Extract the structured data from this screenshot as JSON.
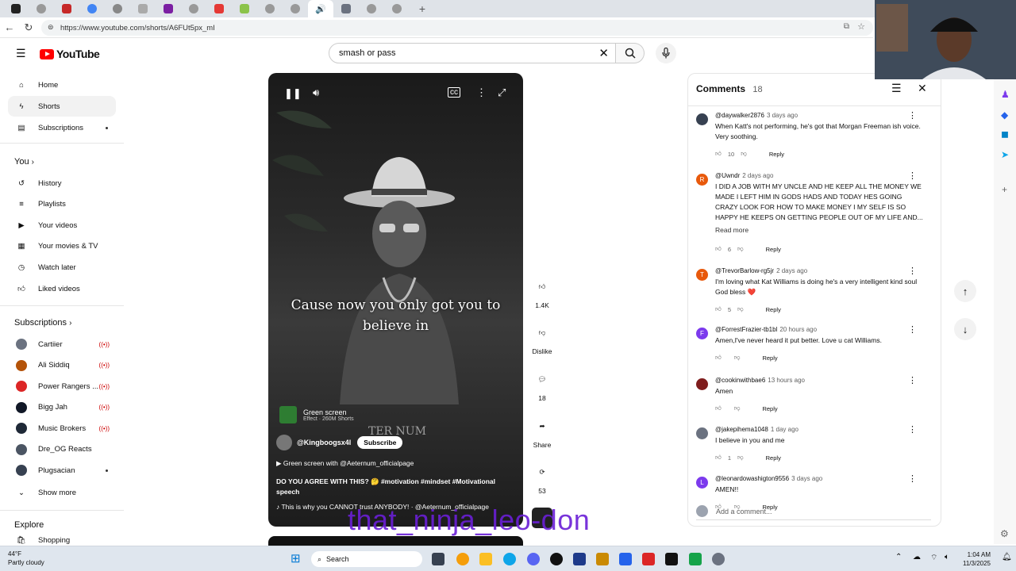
{
  "browser": {
    "url": "https://www.youtube.com/shorts/A6FUt5px_mI"
  },
  "header": {
    "logo_text": "YouTube",
    "search_value": "smash or pass"
  },
  "sidebar": {
    "main": [
      {
        "label": "Home",
        "icon": "home-icon"
      },
      {
        "label": "Shorts",
        "icon": "shorts-icon"
      },
      {
        "label": "Subscriptions",
        "icon": "subscriptions-icon"
      }
    ],
    "you_label": "You",
    "you_items": [
      {
        "label": "History",
        "icon": "history-icon"
      },
      {
        "label": "Playlists",
        "icon": "playlists-icon"
      },
      {
        "label": "Your videos",
        "icon": "your-videos-icon"
      },
      {
        "label": "Your movies & TV",
        "icon": "movies-icon"
      },
      {
        "label": "Watch later",
        "icon": "watch-later-icon"
      },
      {
        "label": "Liked videos",
        "icon": "liked-icon"
      }
    ],
    "subs_label": "Subscriptions",
    "subs": [
      {
        "label": "Cartiier",
        "color": "#6b7280",
        "live": "((•))"
      },
      {
        "label": "Ali Siddiq",
        "color": "#b45309",
        "live": "((•))"
      },
      {
        "label": "Power Rangers ...",
        "color": "#dc2626",
        "live": "((•))"
      },
      {
        "label": "Bigg Jah",
        "color": "#111827",
        "live": "((•))"
      },
      {
        "label": "Music Brokers",
        "color": "#1f2937",
        "live": "((•))"
      },
      {
        "label": "Dre_OG Reacts",
        "color": "#4b5563",
        "live": ""
      },
      {
        "label": "Plugsacian",
        "color": "#374151",
        "live": ""
      }
    ],
    "show_more": "Show more",
    "explore": "Explore",
    "shopping": "Shopping"
  },
  "video": {
    "caption_line1": "Cause now you only got you to",
    "caption_line2": "believe in",
    "effect_title": "Green screen",
    "effect_sub": "Effect · 260M Shorts",
    "channel": "@Kingboogsx4l",
    "subscribe": "Subscribe",
    "green_screen_with": "Green screen with @Aeternum_officialpage",
    "description": "DO YOU AGREE WITH THIS? 🤔 #motivation #mindset #Motivational speech",
    "sound": "This is why you CANNOT trust ANYBODY! · @Aeternum_officialpage",
    "watermark": "TER NUM"
  },
  "actions": {
    "likes": "1.4K",
    "dislike": "Dislike",
    "comments": "18",
    "share": "Share",
    "remix": "53"
  },
  "overlay": "that_ninja_leo-don",
  "comments": {
    "title": "Comments",
    "count": "18",
    "items": [
      {
        "user": "@daywalker2876",
        "time": "3 days ago",
        "text": "When Katt's not performing, he's got that Morgan Freeman ish voice. Very soothing.",
        "likes": "10",
        "avatar": "",
        "color": "#374151"
      },
      {
        "user": "@Uwndr",
        "time": "2 days ago",
        "text": "I DID A JOB WITH MY UNCLE AND HE KEEP ALL THE MONEY WE MADE I LEFT HIM IN GODS HADS AND TODAY HES GOING CRAZY LOOK FOR HOW TO MAKE MONEY I MY SELF IS SO HAPPY HE KEEPS ON GETTING PEOPLE OUT OF MY LIFE AND...",
        "likes": "6",
        "avatar": "R",
        "color": "#e8590c",
        "readmore": "Read more"
      },
      {
        "user": "@TrevorBarlow-rg5jr",
        "time": "2 days ago",
        "text": "I'm loving what Kat Williams is doing he's a very intelligent kind soul God bless ❤️",
        "likes": "5",
        "avatar": "T",
        "color": "#e8590c"
      },
      {
        "user": "@ForrestFrazier-tb1bl",
        "time": "20 hours ago",
        "text": "Amen,I've never heard it put better. Love u cat Williams.",
        "likes": "",
        "avatar": "F",
        "color": "#7c3aed"
      },
      {
        "user": "@cookinwithbae6",
        "time": "13 hours ago",
        "text": "Amen",
        "likes": "",
        "avatar": "",
        "color": "#7f1d1d"
      },
      {
        "user": "@jakepihema1048",
        "time": "1 day ago",
        "text": "I believe in you and me",
        "likes": "1",
        "avatar": "",
        "color": "#6b7280"
      },
      {
        "user": "@leonardowashigton9556",
        "time": "3 days ago",
        "text": "AMEN!!",
        "likes": "",
        "avatar": "L",
        "color": "#7c3aed"
      }
    ],
    "reply": "Reply",
    "add_placeholder": "Add a comment..."
  },
  "taskbar": {
    "temp": "44°F",
    "weather": "Partly cloudy",
    "search": "Search",
    "time": "1:04 AM",
    "date": "11/3/2025"
  }
}
